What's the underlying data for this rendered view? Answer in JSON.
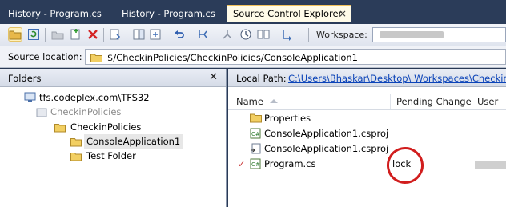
{
  "tabs": [
    {
      "label": "History - Program.cs",
      "active": false
    },
    {
      "label": "History - Program.cs",
      "active": false
    },
    {
      "label": "Source Control Explorer",
      "active": true,
      "close": "×"
    }
  ],
  "toolbar": {
    "workspace_label": "Workspace:",
    "workspace_value": ""
  },
  "source_location": {
    "label": "Source location:",
    "path": "$/CheckinPolicies/CheckinPolicies/ConsoleApplication1"
  },
  "folders_pane": {
    "title": "Folders",
    "close": "✕",
    "tree": [
      {
        "label": "tfs.codeplex.com\\TFS32",
        "greyed": false
      },
      {
        "label": "CheckinPolicies",
        "greyed": true
      },
      {
        "label": "CheckinPolicies",
        "greyed": false
      },
      {
        "label": "ConsoleApplication1",
        "greyed": false,
        "selected": true
      },
      {
        "label": "Test Folder",
        "greyed": false
      }
    ]
  },
  "items_pane": {
    "local_path_label": "Local Path:",
    "local_path": "C:\\Users\\Bhaskar\\Desktop\\     Workspaces\\CheckinP",
    "columns": [
      "Name",
      "Pending Change",
      "User"
    ],
    "rows": [
      {
        "name": "Properties",
        "icon": "folder-icon",
        "pending": "",
        "checked": false
      },
      {
        "name": "ConsoleApplication1.csproj",
        "icon": "csproj-icon",
        "pending": "",
        "checked": false
      },
      {
        "name": "ConsoleApplication1.csproj",
        "icon": "csproj-user-icon",
        "pending": "",
        "checked": false
      },
      {
        "name": "Program.cs",
        "icon": "cs-file-icon",
        "pending": "lock",
        "checked": true,
        "check": "✓"
      }
    ]
  },
  "colors": {
    "tab_strip": "#2b3c59",
    "active_tab": "#fffbe8",
    "link": "#0b43b8",
    "annotation": "#d11d1d"
  }
}
